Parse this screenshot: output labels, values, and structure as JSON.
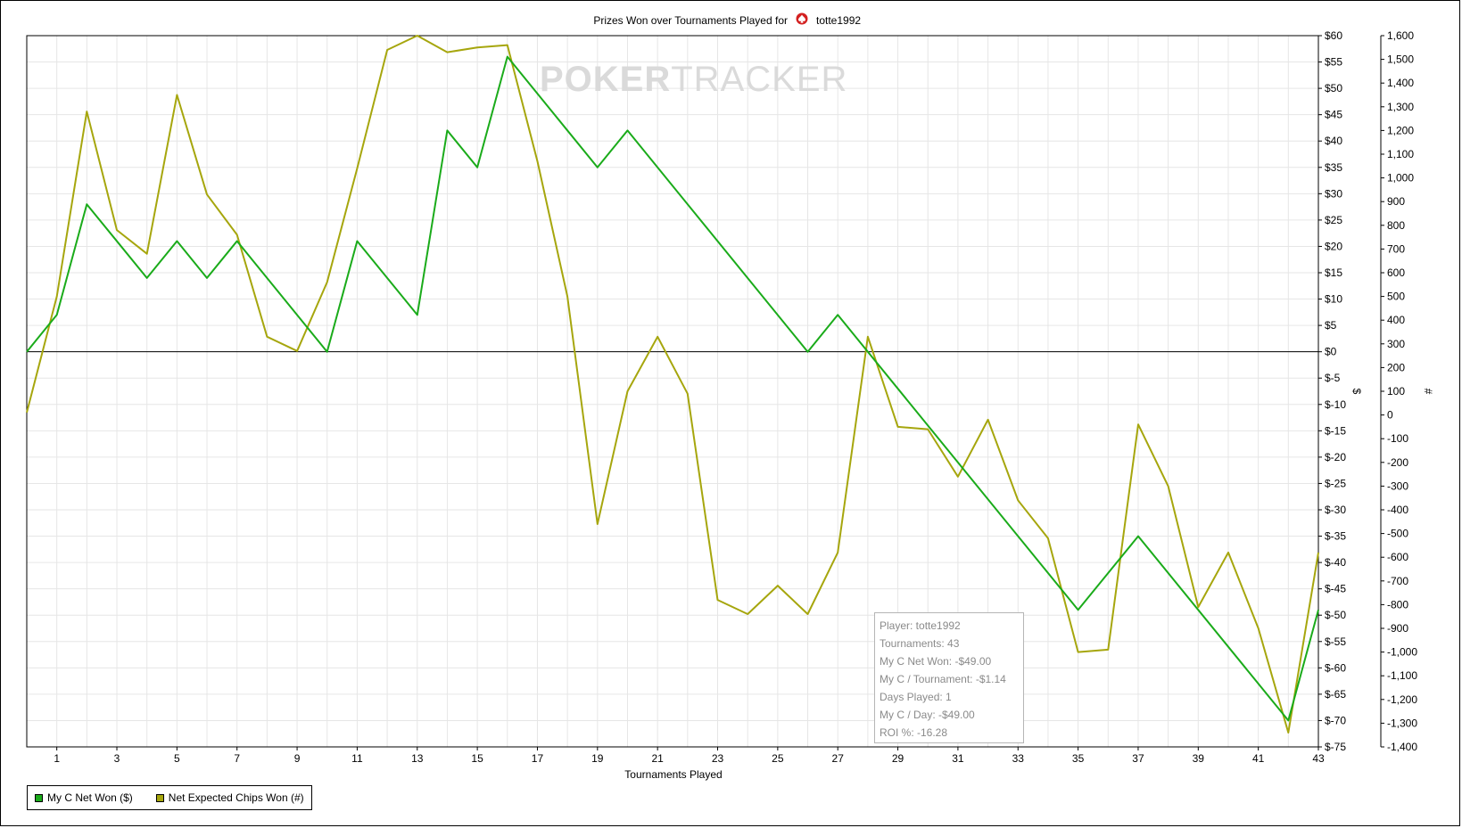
{
  "colors": {
    "net_won": "#1aab1a",
    "expected_chips": "#a6a60d",
    "grid": "#e6e6e6",
    "axis": "#000000",
    "watermark": "#dadada"
  },
  "watermark": {
    "text_bold": "POKER",
    "text_light": "TRACKER"
  },
  "chart_data": {
    "type": "line",
    "title": "Prizes Won over Tournaments Played for",
    "title_player": "totte1992",
    "title_icon": "spade-icon",
    "xlabel": "Tournaments Played",
    "ylabel_left": "$",
    "ylabel_right": "#",
    "xlim": [
      0,
      43
    ],
    "x_ticks": [
      1,
      3,
      5,
      7,
      9,
      11,
      13,
      15,
      17,
      19,
      21,
      23,
      25,
      27,
      29,
      31,
      33,
      35,
      37,
      39,
      41,
      43
    ],
    "y1lim": [
      -75,
      60
    ],
    "y1_ticks": [
      60,
      55,
      50,
      45,
      40,
      35,
      30,
      25,
      20,
      15,
      10,
      5,
      0,
      -5,
      -10,
      -15,
      -20,
      -25,
      -30,
      -35,
      -40,
      -45,
      -50,
      -55,
      -60,
      -65,
      -70,
      -75
    ],
    "y1_tick_labels": [
      "$60",
      "$55",
      "$50",
      "$45",
      "$40",
      "$35",
      "$30",
      "$25",
      "$20",
      "$15",
      "$10",
      "$5",
      "$0",
      "$-5",
      "$-10",
      "$-15",
      "$-20",
      "$-25",
      "$-30",
      "$-35",
      "$-40",
      "$-45",
      "$-50",
      "$-55",
      "$-60",
      "$-65",
      "$-70",
      "$-75"
    ],
    "y2lim": [
      -1400,
      1600
    ],
    "y2_ticks": [
      1600,
      1500,
      1400,
      1300,
      1200,
      1100,
      1000,
      900,
      800,
      700,
      600,
      500,
      400,
      300,
      200,
      100,
      0,
      -100,
      -200,
      -300,
      -400,
      -500,
      -600,
      -700,
      -800,
      -900,
      -1000,
      -1100,
      -1200,
      -1300,
      -1400
    ],
    "y2_tick_labels": [
      "1,600",
      "1,500",
      "1,400",
      "1,300",
      "1,200",
      "1,100",
      "1,000",
      "900",
      "800",
      "700",
      "600",
      "500",
      "400",
      "300",
      "200",
      "100",
      "0",
      "-100",
      "-200",
      "-300",
      "-400",
      "-500",
      "-600",
      "-700",
      "-800",
      "-900",
      "-1,000",
      "-1,100",
      "-1,200",
      "-1,300",
      "-1,400"
    ],
    "grid": true,
    "legend_position": "bottom-left",
    "series": [
      {
        "name": "My C Net Won ($)",
        "axis": "left",
        "x": [
          0,
          1,
          2,
          4,
          5,
          6,
          7,
          10,
          11,
          13,
          14,
          15,
          16,
          19,
          20,
          26,
          27,
          35,
          37,
          42,
          43
        ],
        "values": [
          0,
          7,
          28,
          14,
          21,
          14,
          21,
          0,
          21,
          7,
          42,
          35,
          56,
          35,
          42,
          0,
          7,
          -49,
          -35,
          -70,
          -49
        ]
      },
      {
        "name": "Net Expected Chips Won (#)",
        "axis": "right",
        "x": [
          0,
          1,
          2,
          3,
          4,
          5,
          6,
          7,
          8,
          9,
          10,
          11,
          12,
          13,
          14,
          15,
          16,
          17,
          18,
          19,
          20,
          21,
          22,
          23,
          24,
          25,
          26,
          27,
          28,
          29,
          30,
          31,
          32,
          33,
          34,
          35,
          36,
          37,
          38,
          39,
          40,
          41,
          42,
          43
        ],
        "values": [
          10,
          500,
          1280,
          780,
          680,
          1350,
          930,
          760,
          330,
          270,
          560,
          1040,
          1540,
          1600,
          1530,
          1550,
          1560,
          1070,
          500,
          -460,
          100,
          330,
          90,
          -780,
          -840,
          -720,
          -840,
          -580,
          330,
          -50,
          -60,
          -260,
          -20,
          -360,
          -520,
          -1000,
          -990,
          -40,
          -300,
          -810,
          -580,
          -900,
          -1340,
          -580
        ]
      }
    ]
  },
  "legend": {
    "items": [
      {
        "label": "My C Net Won ($)"
      },
      {
        "label": "Net Expected Chips Won (#)"
      }
    ]
  },
  "tooltip": {
    "lines": [
      "Player: totte1992",
      "Tournaments: 43",
      "My C Net Won: -$49.00",
      "My C / Tournament: -$1.14",
      "Days Played: 1",
      "My C / Day: -$49.00",
      "ROI %: -16.28"
    ]
  }
}
